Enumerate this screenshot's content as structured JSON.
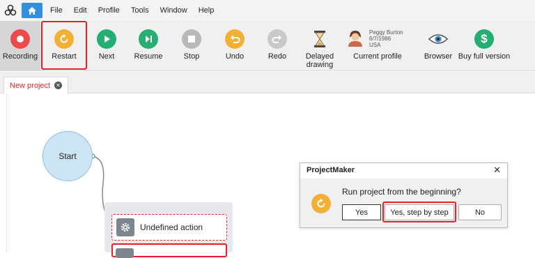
{
  "menubar": {
    "items": [
      "File",
      "Edit",
      "Profile",
      "Tools",
      "Window",
      "Help"
    ]
  },
  "toolbar": {
    "items": [
      {
        "label": "Recording",
        "icon": "record-icon",
        "color": "#ee4a4a"
      },
      {
        "label": "Restart",
        "icon": "restart-icon",
        "color": "#f2b134"
      },
      {
        "label": "Next",
        "icon": "next-icon",
        "color": "#27ae73"
      },
      {
        "label": "Resume",
        "icon": "resume-icon",
        "color": "#27ae73"
      },
      {
        "label": "Stop",
        "icon": "stop-icon",
        "color": "#b9b9b9"
      },
      {
        "label": "Undo",
        "icon": "undo-icon",
        "color": "#f2b134"
      },
      {
        "label": "Redo",
        "icon": "redo-icon",
        "color": "#c9c9c9"
      },
      {
        "label": "Delayed\ndrawing",
        "icon": "hourglass-icon",
        "color": "#8a6a3a"
      },
      {
        "label": "Current profile",
        "icon": "profile-avatar",
        "color": "#e9a06b"
      },
      {
        "label": "Browser",
        "icon": "eye-icon",
        "color": "#3a8fd0"
      },
      {
        "label": "Buy full version",
        "icon": "dollar-icon",
        "color": "#27ae73"
      }
    ]
  },
  "profile": {
    "name": "Peggy Burton",
    "dob": "6/7/1986",
    "country": "USA"
  },
  "tab": {
    "label": "New project"
  },
  "diagram": {
    "start_label": "Start",
    "action_label": "Undefined action"
  },
  "dialog": {
    "title": "ProjectMaker",
    "message": "Run project from the beginning?",
    "btn_yes": "Yes",
    "btn_step": "Yes, step by step",
    "btn_no": "No"
  },
  "colors": {
    "highlight": "#e52026",
    "home_blue": "#2f8fe0",
    "tab_red": "#d52d2d"
  }
}
